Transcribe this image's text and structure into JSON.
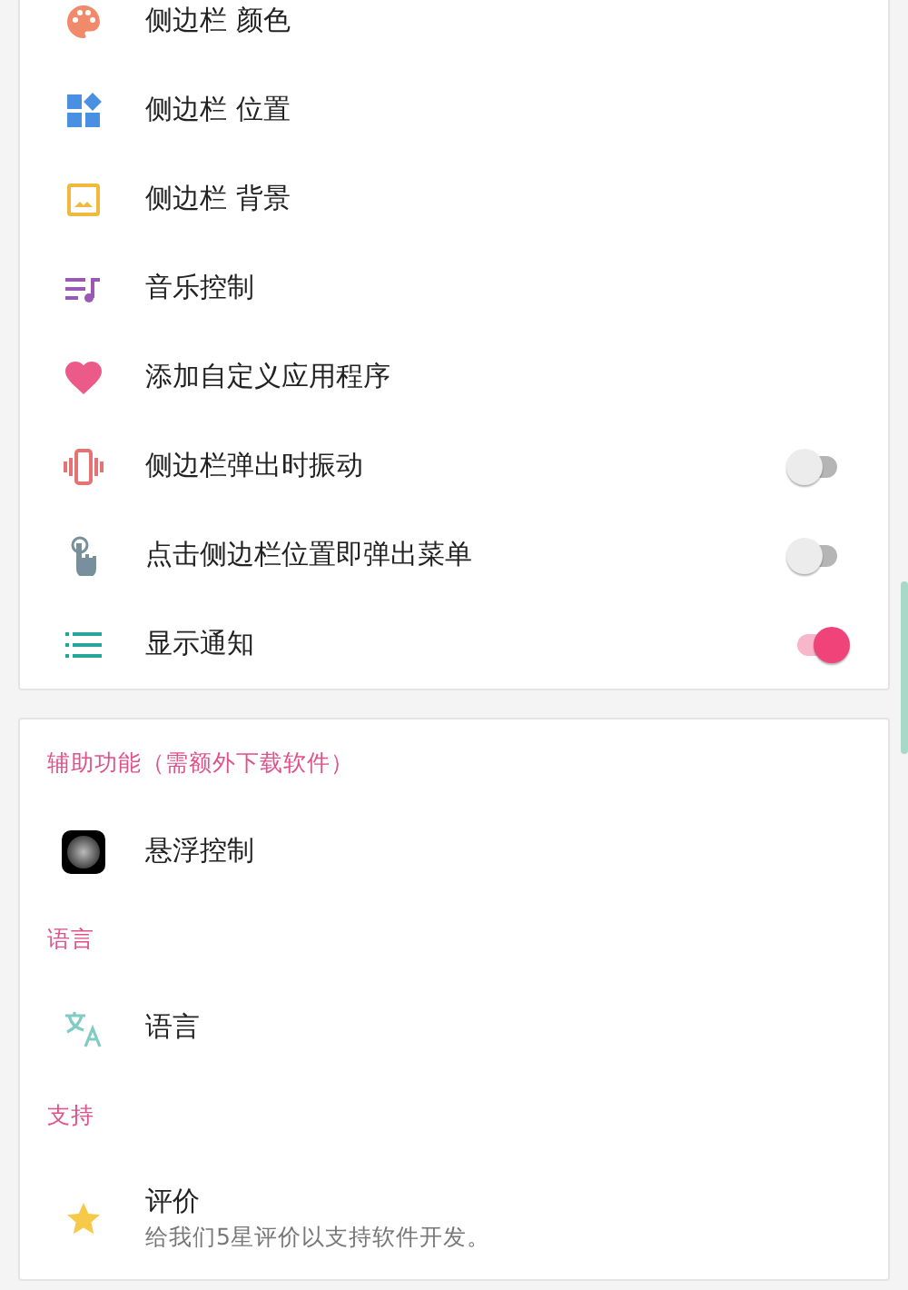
{
  "cards": [
    {
      "sections": [
        {
          "items": [
            {
              "kind": "link",
              "label": "侧边栏 颜色"
            },
            {
              "kind": "link",
              "label": "侧边栏 位置"
            },
            {
              "kind": "link",
              "label": "侧边栏 背景"
            },
            {
              "kind": "link",
              "label": "音乐控制"
            },
            {
              "kind": "link",
              "label": "添加自定义应用程序"
            },
            {
              "kind": "toggle",
              "label": "侧边栏弹出时振动",
              "on": false
            },
            {
              "kind": "toggle",
              "label": "点击侧边栏位置即弹出菜单",
              "on": false
            },
            {
              "kind": "toggle",
              "label": "显示通知",
              "on": true
            }
          ]
        }
      ]
    },
    {
      "sections": [
        {
          "header": "辅助功能（需额外下载软件）",
          "items": [
            {
              "kind": "link",
              "label": "悬浮控制"
            }
          ]
        },
        {
          "header": "语言",
          "items": [
            {
              "kind": "link",
              "label": "语言"
            }
          ]
        },
        {
          "header": "支持",
          "items": [
            {
              "kind": "link",
              "label": "评价",
              "subtitle": "给我们5星评价以支持软件开发。"
            }
          ]
        }
      ]
    }
  ]
}
